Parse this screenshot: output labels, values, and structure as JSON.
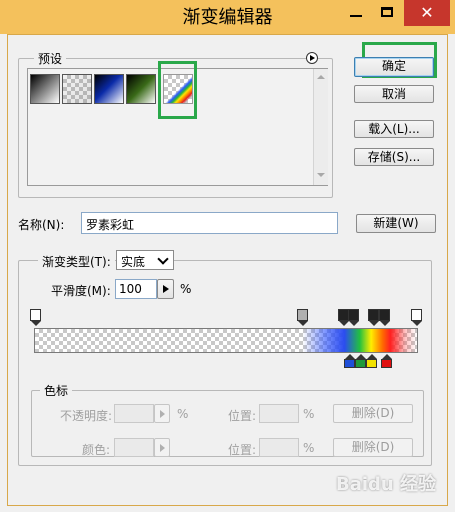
{
  "window": {
    "title": "渐变编辑器",
    "close_glyph": "✕"
  },
  "presets": {
    "group_label": "预设",
    "items": [
      {
        "name": "foreground-to-background"
      },
      {
        "name": "foreground-to-transparent"
      },
      {
        "name": "black-blue-white"
      },
      {
        "name": "black-green-white"
      },
      {
        "name": "rainbow-transparent",
        "selected": true
      }
    ]
  },
  "buttons": {
    "ok": "确定",
    "cancel": "取消",
    "load": "载入(L)...",
    "save": "存储(S)...",
    "new": "新建(W)"
  },
  "name_field": {
    "label": "名称(N):",
    "value": "罗素彩虹"
  },
  "gradient": {
    "type_label": "渐变类型(T):",
    "type_value": "实底",
    "smooth_label": "平滑度(M):",
    "smooth_value": "100",
    "smooth_unit": "%"
  },
  "color_stops_group": {
    "label": "色标",
    "opacity_label": "不透明度:",
    "opacity_unit": "%",
    "position_label_1": "位置:",
    "position_unit_1": "%",
    "delete_label_1": "删除(D)",
    "color_label": "颜色:",
    "position_label_2": "位置:",
    "position_unit_2": "%",
    "delete_label_2": "删除(D)"
  },
  "watermark": "Baidu 经验",
  "colors": {
    "title_bar": "#f4c15c",
    "close_button": "#c6362c",
    "highlight_box": "#2aa84a",
    "stop_colors": [
      "#1f4fd8",
      "#1f9a3a",
      "#f2e200",
      "#e01010"
    ]
  }
}
